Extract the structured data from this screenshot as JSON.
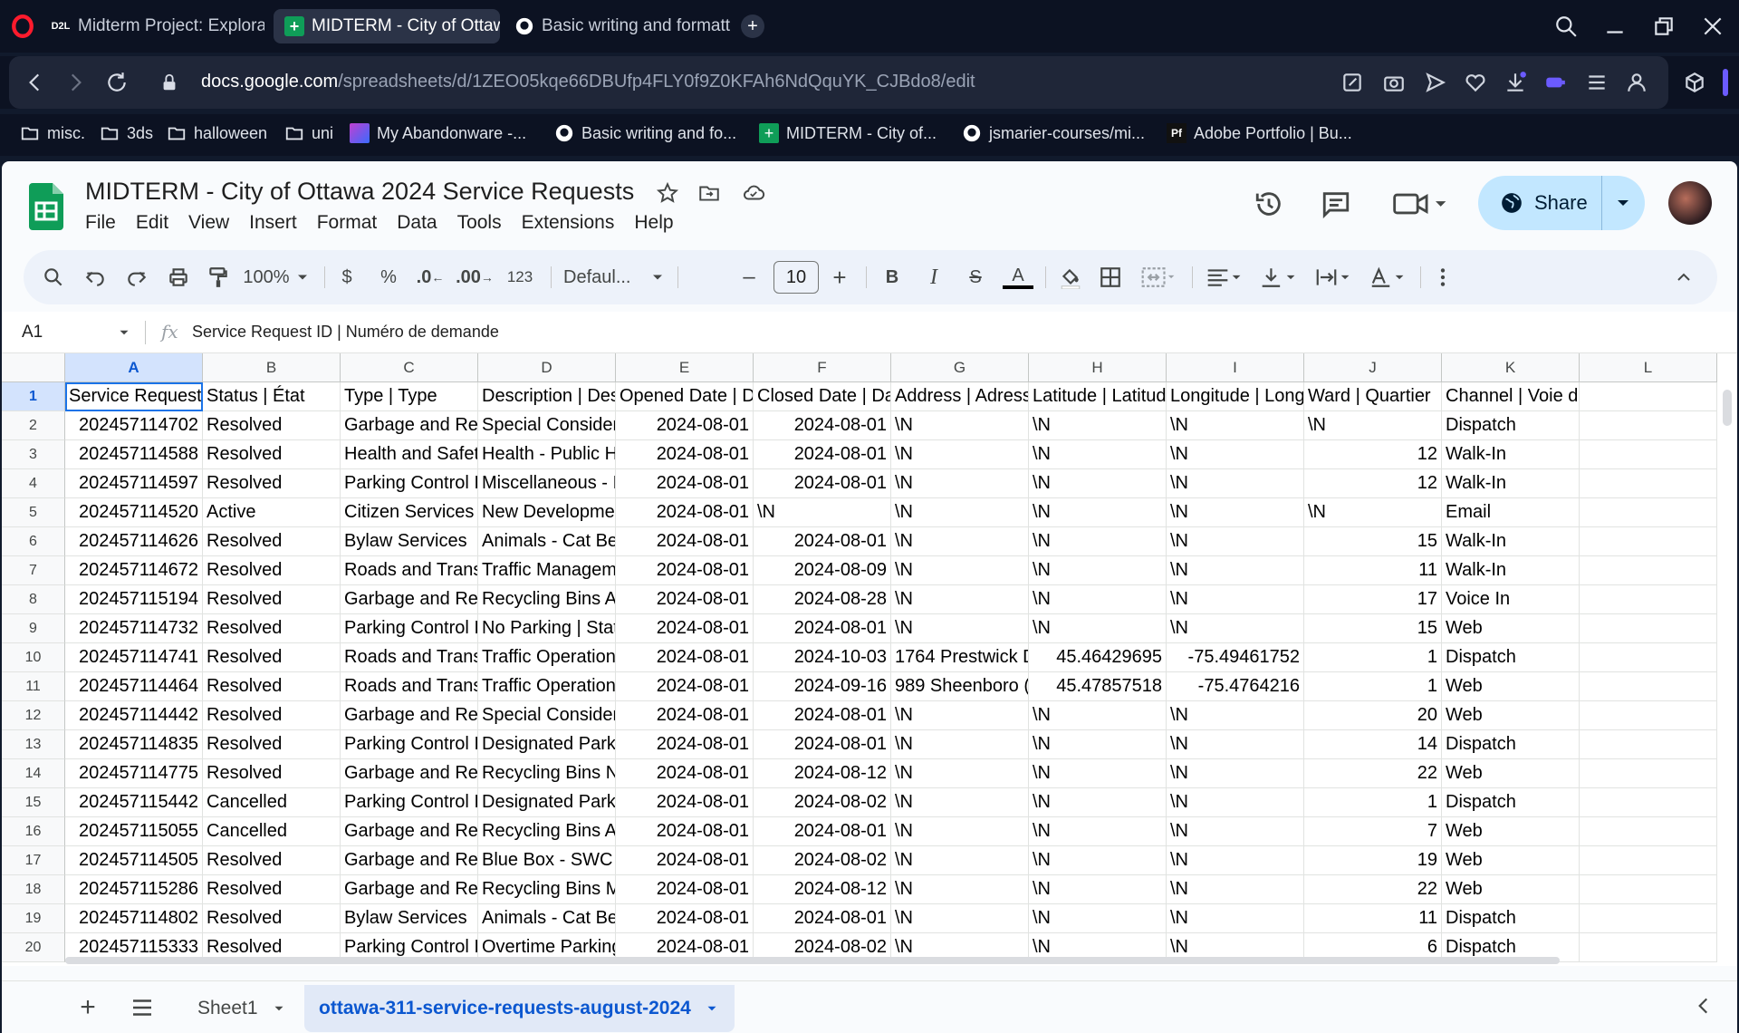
{
  "browser": {
    "tabs": [
      {
        "label": "Midterm Project: Explorato",
        "favicon": "D2L",
        "active": false
      },
      {
        "label": "MIDTERM - City of Ottawa",
        "favicon": "sheets",
        "active": true
      },
      {
        "label": "Basic writing and formattin",
        "favicon": "github",
        "active": false
      }
    ],
    "url_host": "docs.google.com",
    "url_path": "/spreadsheets/d/1ZEO05kqe66DBUfp4FLY0f9Z0KFAh6NdQquYK_CJBdo8/edit",
    "bookmarks": [
      {
        "label": "misc.",
        "icon": "folder-icon"
      },
      {
        "label": "3ds",
        "icon": "folder-icon"
      },
      {
        "label": "halloween",
        "icon": "folder-icon"
      },
      {
        "label": "uni",
        "icon": "folder-icon"
      },
      {
        "label": "My Abandonware -...",
        "icon": "abandonware-icon"
      },
      {
        "label": "Basic writing and fo...",
        "icon": "github-icon"
      },
      {
        "label": "MIDTERM - City of...",
        "icon": "sheets-icon"
      },
      {
        "label": "jsmarier-courses/mi...",
        "icon": "github-icon"
      },
      {
        "label": "Adobe Portfolio | Bu...",
        "icon": "portfolio-icon"
      }
    ],
    "portfolio_badge": "Pf",
    "d2l_badge": "D2L"
  },
  "doc": {
    "title": "MIDTERM - City of Ottawa 2024 Service Requests",
    "menu": [
      "File",
      "Edit",
      "View",
      "Insert",
      "Format",
      "Data",
      "Tools",
      "Extensions",
      "Help"
    ],
    "share_label": "Share"
  },
  "toolbar": {
    "zoom": "100%",
    "currency": "$",
    "percent": "%",
    "dec_decrease": ".0",
    "dec_increase": ".00",
    "number_format": "123",
    "font": "Defaul...",
    "font_size": "10",
    "minus": "–",
    "plus": "+",
    "bold": "B",
    "italic": "I",
    "strike": "S",
    "text_color": "A"
  },
  "formula_bar": {
    "cell_ref": "A1",
    "fx": "fx",
    "content": "Service Request ID | Numéro de demande"
  },
  "columns": [
    "A",
    "B",
    "C",
    "D",
    "E",
    "F",
    "G",
    "H",
    "I",
    "J",
    "K",
    "L"
  ],
  "rows": [
    {
      "n": "1",
      "cells": [
        "Service Request",
        "Status | État",
        "Type | Type",
        "Description | Des",
        "Opened Date | D",
        "Closed Date | Da",
        "Address | Adress",
        "Latitude | Latitud",
        "Longitude | Long",
        "Ward | Quartier",
        "Channel | Voie de service",
        ""
      ]
    },
    {
      "n": "2",
      "cells": [
        "202457114702",
        "Resolved",
        "Garbage and Re",
        "Special Consider",
        "2024-08-01",
        "2024-08-01",
        "\\N",
        "\\N",
        "\\N",
        "\\N",
        "Dispatch",
        ""
      ]
    },
    {
      "n": "3",
      "cells": [
        "202457114588",
        "Resolved",
        "Health and Safet",
        "Health - Public H",
        "2024-08-01",
        "2024-08-01",
        "\\N",
        "\\N",
        "\\N",
        "12",
        "Walk-In",
        ""
      ]
    },
    {
      "n": "4",
      "cells": [
        "202457114597",
        "Resolved",
        "Parking Control I",
        "Miscellaneous - I",
        "2024-08-01",
        "2024-08-01",
        "\\N",
        "\\N",
        "\\N",
        "12",
        "Walk-In",
        ""
      ]
    },
    {
      "n": "5",
      "cells": [
        "202457114520",
        "Active",
        "Citizen Services",
        "New Developme",
        "2024-08-01",
        "\\N",
        "\\N",
        "\\N",
        "\\N",
        "\\N",
        "Email",
        ""
      ]
    },
    {
      "n": "6",
      "cells": [
        "202457114626",
        "Resolved",
        "Bylaw Services",
        "Animals - Cat Be",
        "2024-08-01",
        "2024-08-01",
        "\\N",
        "\\N",
        "\\N",
        "15",
        "Walk-In",
        ""
      ]
    },
    {
      "n": "7",
      "cells": [
        "202457114672",
        "Resolved",
        "Roads and Trans",
        "Traffic Managem",
        "2024-08-01",
        "2024-08-09",
        "\\N",
        "\\N",
        "\\N",
        "11",
        "Walk-In",
        ""
      ]
    },
    {
      "n": "8",
      "cells": [
        "202457115194",
        "Resolved",
        "Garbage and Re",
        "Recycling Bins A",
        "2024-08-01",
        "2024-08-28",
        "\\N",
        "\\N",
        "\\N",
        "17",
        "Voice In",
        ""
      ]
    },
    {
      "n": "9",
      "cells": [
        "202457114732",
        "Resolved",
        "Parking Control I",
        "No Parking | Stat",
        "2024-08-01",
        "2024-08-01",
        "\\N",
        "\\N",
        "\\N",
        "15",
        "Web",
        ""
      ]
    },
    {
      "n": "10",
      "cells": [
        "202457114741",
        "Resolved",
        "Roads and Trans",
        "Traffic Operation",
        "2024-08-01",
        "2024-10-03",
        "1764 Prestwick D",
        "45.46429695",
        "-75.49461752",
        "1",
        "Dispatch",
        ""
      ]
    },
    {
      "n": "11",
      "cells": [
        "202457114464",
        "Resolved",
        "Roads and Trans",
        "Traffic Operation",
        "2024-08-01",
        "2024-09-16",
        "989 Sheenboro (",
        "45.47857518",
        "-75.4764216",
        "1",
        "Web",
        ""
      ]
    },
    {
      "n": "12",
      "cells": [
        "202457114442",
        "Resolved",
        "Garbage and Re",
        "Special Consider",
        "2024-08-01",
        "2024-08-01",
        "\\N",
        "\\N",
        "\\N",
        "20",
        "Web",
        ""
      ]
    },
    {
      "n": "13",
      "cells": [
        "202457114835",
        "Resolved",
        "Parking Control I",
        "Designated Park",
        "2024-08-01",
        "2024-08-01",
        "\\N",
        "\\N",
        "\\N",
        "14",
        "Dispatch",
        ""
      ]
    },
    {
      "n": "14",
      "cells": [
        "202457114775",
        "Resolved",
        "Garbage and Re",
        "Recycling Bins N",
        "2024-08-01",
        "2024-08-12",
        "\\N",
        "\\N",
        "\\N",
        "22",
        "Web",
        ""
      ]
    },
    {
      "n": "15",
      "cells": [
        "202457115442",
        "Cancelled",
        "Parking Control I",
        "Designated Park",
        "2024-08-01",
        "2024-08-02",
        "\\N",
        "\\N",
        "\\N",
        "1",
        "Dispatch",
        ""
      ]
    },
    {
      "n": "16",
      "cells": [
        "202457115055",
        "Cancelled",
        "Garbage and Re",
        "Recycling Bins A",
        "2024-08-01",
        "2024-08-01",
        "\\N",
        "\\N",
        "\\N",
        "7",
        "Web",
        ""
      ]
    },
    {
      "n": "17",
      "cells": [
        "202457114505",
        "Resolved",
        "Garbage and Re",
        "Blue Box - SWC",
        "2024-08-01",
        "2024-08-02",
        "\\N",
        "\\N",
        "\\N",
        "19",
        "Web",
        ""
      ]
    },
    {
      "n": "18",
      "cells": [
        "202457115286",
        "Resolved",
        "Garbage and Re",
        "Recycling Bins M",
        "2024-08-01",
        "2024-08-12",
        "\\N",
        "\\N",
        "\\N",
        "22",
        "Web",
        ""
      ]
    },
    {
      "n": "19",
      "cells": [
        "202457114802",
        "Resolved",
        "Bylaw Services",
        "Animals - Cat Be",
        "2024-08-01",
        "2024-08-01",
        "\\N",
        "\\N",
        "\\N",
        "11",
        "Dispatch",
        ""
      ]
    },
    {
      "n": "20",
      "cells": [
        "202457115333",
        "Resolved",
        "Parking Control I",
        "Overtime Parking",
        "2024-08-01",
        "2024-08-02",
        "\\N",
        "\\N",
        "\\N",
        "6",
        "Dispatch",
        ""
      ]
    }
  ],
  "sheets": {
    "add": "+",
    "tabs": [
      {
        "label": "Sheet1",
        "active": false
      },
      {
        "label": "ottawa-311-service-requests-august-2024",
        "active": true
      }
    ]
  },
  "colors": {
    "accent": "#0b57d0",
    "share_bg": "#c2e7ff",
    "sheets_green": "#0f9d58"
  }
}
